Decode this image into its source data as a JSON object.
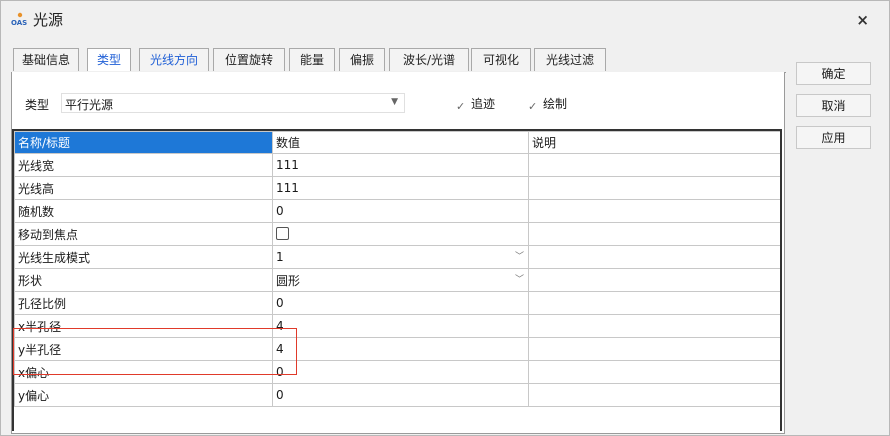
{
  "window": {
    "title": "光源",
    "logo": "OAS",
    "close_label": "×"
  },
  "tabs": [
    {
      "label": "基础信息",
      "state": "normal"
    },
    {
      "label": "类型",
      "state": "active"
    },
    {
      "label": "光线方向",
      "state": "blue"
    },
    {
      "label": "位置旋转",
      "state": "normal"
    },
    {
      "label": "能量",
      "state": "normal"
    },
    {
      "label": "偏振",
      "state": "normal"
    },
    {
      "label": "波长/光谱",
      "state": "normal"
    },
    {
      "label": "可视化",
      "state": "normal"
    },
    {
      "label": "光线过滤",
      "state": "normal"
    }
  ],
  "type_field": {
    "label": "类型",
    "value": "平行光源"
  },
  "checks": {
    "trace": {
      "label": "追迹",
      "checked": true,
      "mark": "✓"
    },
    "draw": {
      "label": "绘制",
      "checked": true,
      "mark": "✓"
    }
  },
  "table": {
    "headers": [
      "名称/标题",
      "数值",
      "说明"
    ],
    "rows": [
      {
        "name": "光线宽",
        "value": "111",
        "kind": "text"
      },
      {
        "name": "光线高",
        "value": "111",
        "kind": "text"
      },
      {
        "name": "随机数",
        "value": "0",
        "kind": "text"
      },
      {
        "name": "移动到焦点",
        "value": "",
        "kind": "checkbox",
        "checked": false
      },
      {
        "name": "光线生成模式",
        "value": "1",
        "kind": "dropdown"
      },
      {
        "name": "形状",
        "value": "圆形",
        "kind": "dropdown"
      },
      {
        "name": "孔径比例",
        "value": "0",
        "kind": "text"
      },
      {
        "name": "x半孔径",
        "value": "4",
        "kind": "text"
      },
      {
        "name": "y半孔径",
        "value": "4",
        "kind": "text"
      },
      {
        "name": "x偏心",
        "value": "0",
        "kind": "text"
      },
      {
        "name": "y偏心",
        "value": "0",
        "kind": "text"
      }
    ]
  },
  "buttons": {
    "ok": "确定",
    "cancel": "取消",
    "apply": "应用"
  },
  "colors": {
    "accent": "#1f5fd6",
    "header_selected": "#1e78d7",
    "highlight": "#e03a2a"
  }
}
